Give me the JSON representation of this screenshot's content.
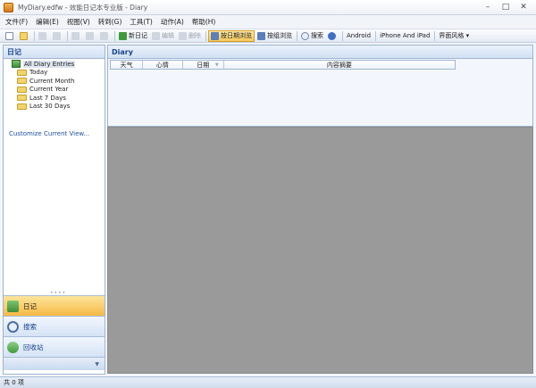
{
  "window": {
    "title": "MyDiary.edfw - 效能日记本专业版 - Diary",
    "controls": [
      "–",
      "□",
      "✕"
    ]
  },
  "menu": [
    "文件(F)",
    "编辑(E)",
    "视图(V)",
    "转到(G)",
    "工具(T)",
    "动作(A)",
    "帮助(H)"
  ],
  "toolbar": {
    "new_diary": "新日记",
    "edit": "编辑",
    "delete": "删除",
    "by_date": "按日期浏览",
    "by_group": "按组浏览",
    "search": "搜索",
    "android": "Android",
    "iphone_ipad": "iPhone And iPad",
    "theme": "界面风格 ▾"
  },
  "left": {
    "header": "日记",
    "tree": {
      "root": "All Diary Entries",
      "children": [
        "Today",
        "Current Month",
        "Current Year",
        "Last 7 Days",
        "Last 30 Days"
      ]
    },
    "customize": "Customize Current View...",
    "nav": {
      "diary": "日记",
      "search": "搜索",
      "recycle": "回收站"
    }
  },
  "right": {
    "header": "Diary",
    "columns": [
      "天气",
      "心情",
      "日期",
      "内容摘要"
    ]
  },
  "status": "共 0 项",
  "colors": {
    "accent": "#15428b",
    "active_tab": "#f7c95a",
    "preview_bg": "#9a9a9a"
  }
}
